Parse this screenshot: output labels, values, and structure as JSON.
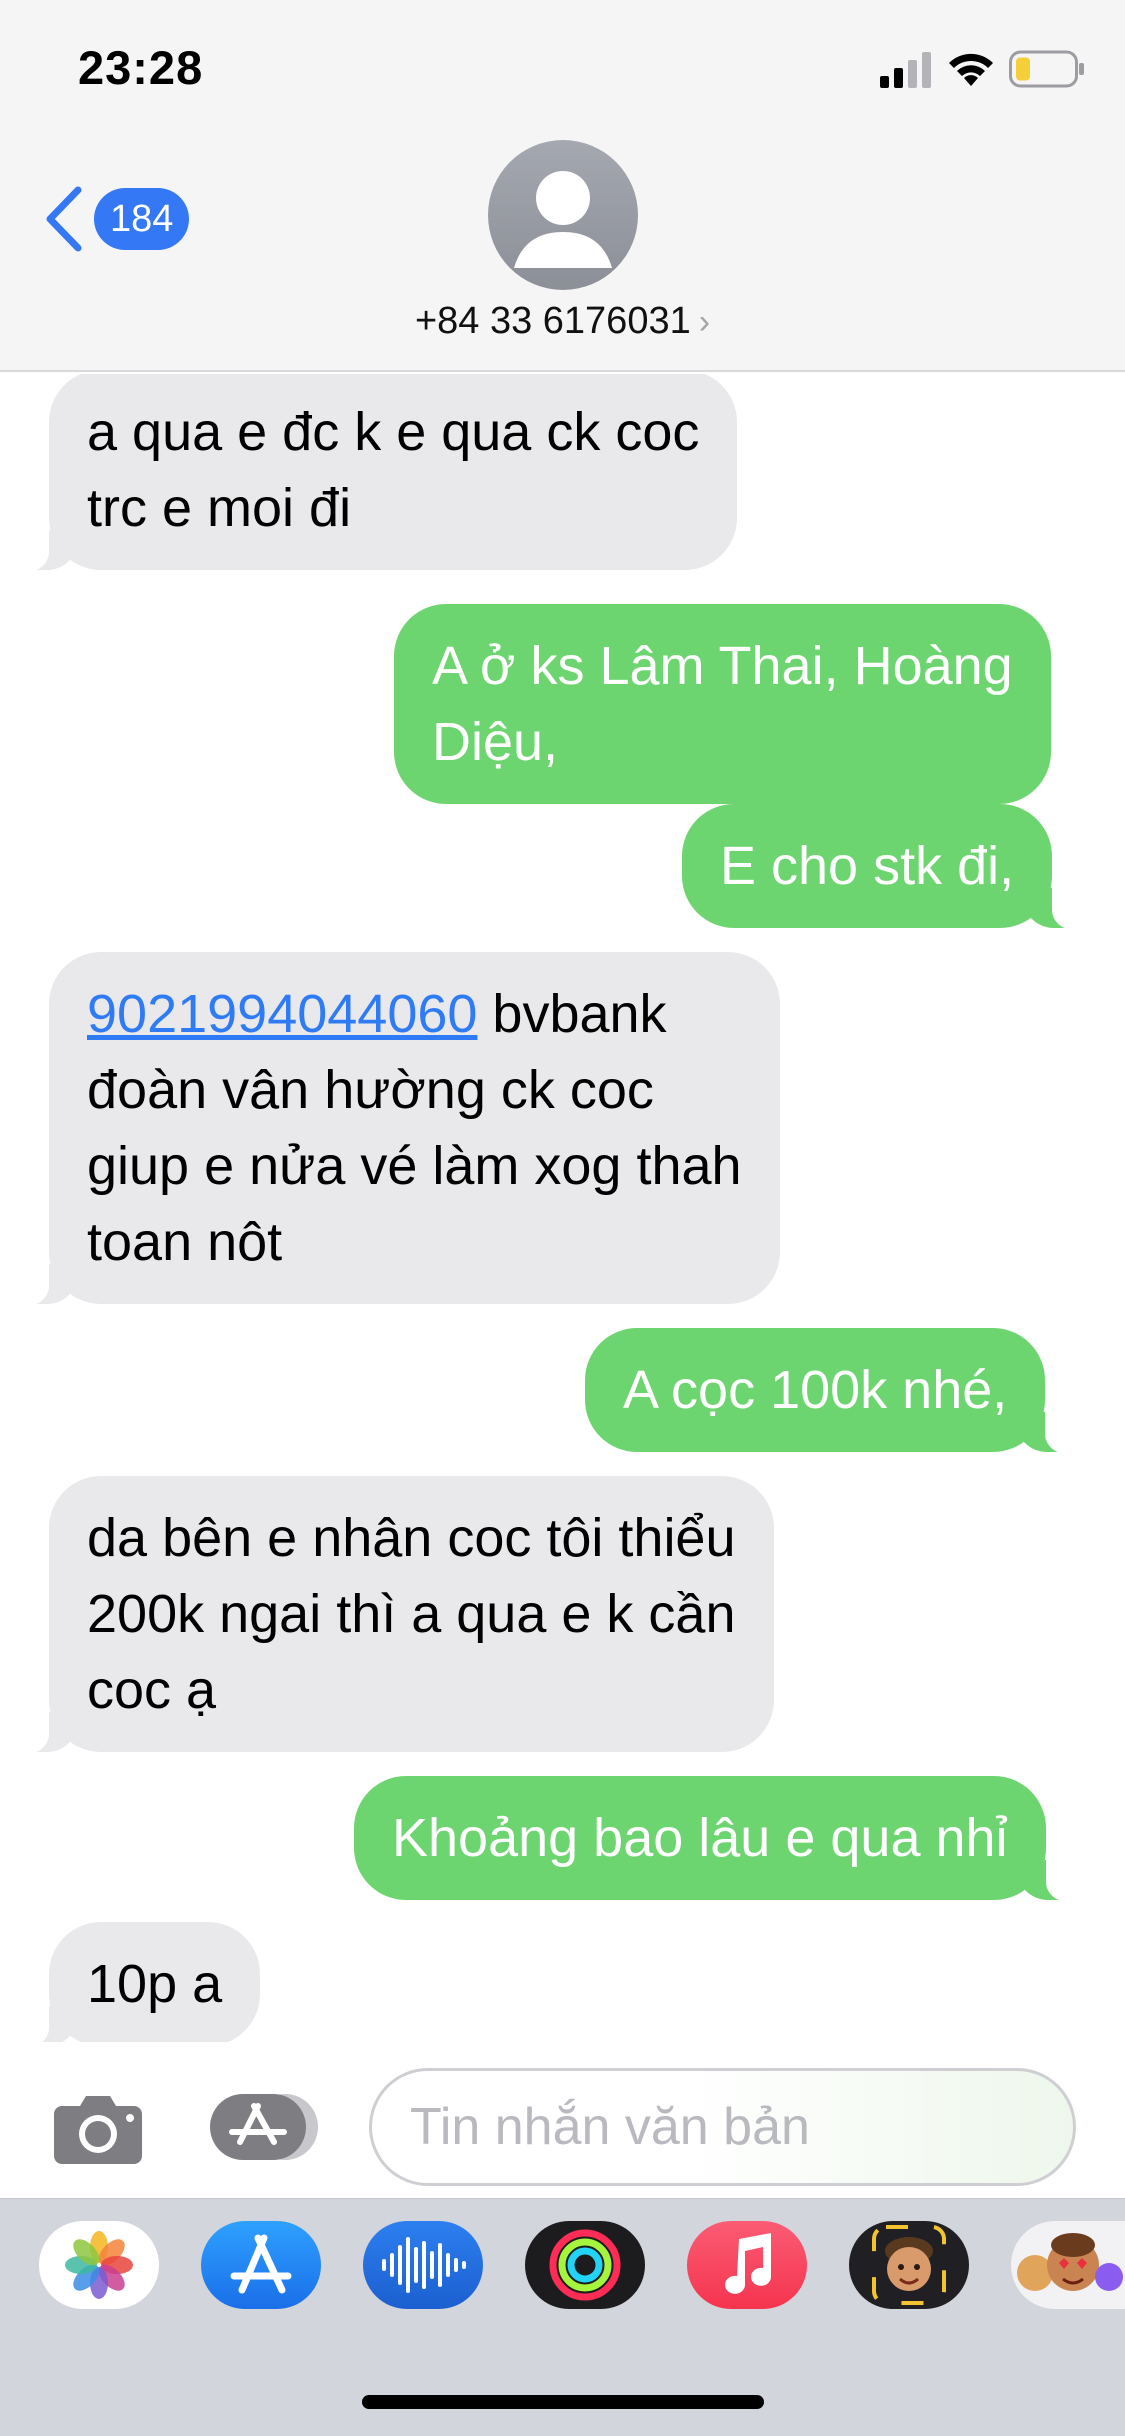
{
  "status_bar": {
    "time": "23:28",
    "icons": [
      "signal-icon",
      "wifi-icon",
      "battery-icon"
    ]
  },
  "header": {
    "back_badge": "184",
    "contact_name": "+84 33 6176031",
    "contact_chevron": "›"
  },
  "messages": [
    {
      "from": "contact",
      "lines": [
        "a qua e đc k e qua ck coc",
        "trc e moi đi"
      ]
    },
    {
      "from": "me",
      "lines": [
        "A ở ks Lâm Thai, Hoàng",
        "Diệu,"
      ]
    },
    {
      "from": "me",
      "lines": [
        "E cho stk đi,"
      ]
    },
    {
      "from": "contact",
      "link": "9021994044060",
      "first_line_rest": " bvbank",
      "lines": [
        "đoàn vân hường ck coc",
        "giup e nửa vé làm xog thah",
        "toan nôt"
      ]
    },
    {
      "from": "me",
      "lines": [
        "A cọc 100k nhé,"
      ]
    },
    {
      "from": "contact",
      "lines": [
        "da bên e nhân coc tôi thiểu",
        "200k ngai thì a qua e k cần",
        "coc ạ"
      ]
    },
    {
      "from": "me",
      "lines": [
        "Khoảng bao  lâu e qua nhỉ"
      ]
    },
    {
      "from": "contact",
      "lines": [
        "10p a"
      ]
    }
  ],
  "input": {
    "placeholder": "Tin nhắn văn bản"
  },
  "colors": {
    "outgoing_bubble": "#6dd56f",
    "incoming_bubble": "#e9e9eb",
    "accent": "#3478f6",
    "link": "#2f7bf5"
  },
  "app_drawer": {
    "apps": [
      "photos-icon",
      "app-store-icon",
      "audio-message-icon",
      "activity-icon",
      "music-icon",
      "memoji-icon",
      "animoji-stickers-icon"
    ]
  }
}
